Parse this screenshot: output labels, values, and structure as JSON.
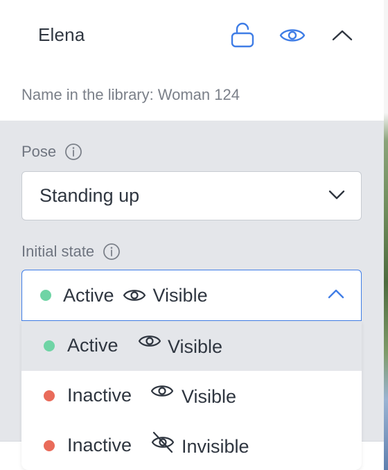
{
  "character": {
    "name": "Elena",
    "lock_icon": "unlock-icon",
    "visibility_icon": "eye-icon",
    "collapse_icon": "chevron-up-icon"
  },
  "library": {
    "label": "Name in the library:",
    "value": "Woman 124"
  },
  "pose": {
    "label": "Pose",
    "info_icon": "info-icon",
    "selected": "Standing up",
    "chevron_icon": "chevron-down-icon"
  },
  "initial_state": {
    "label": "Initial state",
    "info_icon": "info-icon",
    "selected": {
      "status": "Active",
      "status_color": "#6fd4a5",
      "visibility": "Visible",
      "visibility_icon": "eye-icon"
    },
    "chevron_icon": "chevron-up-icon",
    "options": [
      {
        "status": "Active",
        "status_color": "#6fd4a5",
        "visibility": "Visible",
        "visibility_icon": "eye-icon",
        "selected": true
      },
      {
        "status": "Inactive",
        "status_color": "#e96b5a",
        "visibility": "Visible",
        "visibility_icon": "eye-icon",
        "selected": false
      },
      {
        "status": "Inactive",
        "status_color": "#e96b5a",
        "visibility": "Invisible",
        "visibility_icon": "eye-off-icon",
        "selected": false
      }
    ]
  },
  "colors": {
    "accent": "#3f7de6",
    "active": "#6fd4a5",
    "inactive": "#e96b5a"
  }
}
